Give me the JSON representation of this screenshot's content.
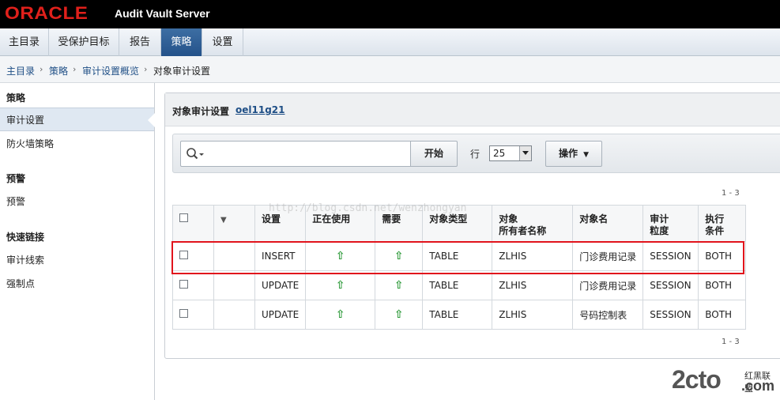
{
  "banner": {
    "logo": "ORACLE",
    "product": "Audit Vault Server"
  },
  "tabs": [
    {
      "label": "主目录",
      "active": false
    },
    {
      "label": "受保护目标",
      "active": false
    },
    {
      "label": "报告",
      "active": false
    },
    {
      "label": "策略",
      "active": true
    },
    {
      "label": "设置",
      "active": false
    }
  ],
  "breadcrumb": [
    "主目录",
    "策略",
    "审计设置概览",
    "对象审计设置"
  ],
  "sidebar": {
    "sections": [
      {
        "heading": "策略",
        "items": [
          {
            "label": "审计设置",
            "active": true
          },
          {
            "label": "防火墙策略",
            "active": false
          }
        ]
      },
      {
        "heading": "预警",
        "items": [
          {
            "label": "预警",
            "active": false
          }
        ]
      },
      {
        "heading": "快速链接",
        "items": [
          {
            "label": "审计线索",
            "active": false
          },
          {
            "label": "强制点",
            "active": false
          }
        ]
      }
    ]
  },
  "panel": {
    "title": "对象审计设置",
    "target_link": "oel11g21"
  },
  "toolbar": {
    "search_value": "",
    "go_label": "开始",
    "rows_label": "行",
    "rows_value": "25",
    "actions_label": "操作"
  },
  "range_top": "1 - 3",
  "range_bottom": "1 - 3",
  "table": {
    "headers": [
      "",
      "",
      "设置",
      "正在使用",
      "需要",
      "对象类型",
      "对象\n所有者名称",
      "对象名",
      "审计\n粒度",
      "执行\n条件"
    ],
    "rows": [
      {
        "setting": "INSERT",
        "type": "TABLE",
        "owner": "ZLHIS",
        "name": "门诊费用记录",
        "granularity": "SESSION",
        "condition": "BOTH"
      },
      {
        "setting": "UPDATE",
        "type": "TABLE",
        "owner": "ZLHIS",
        "name": "门诊费用记录",
        "granularity": "SESSION",
        "condition": "BOTH"
      },
      {
        "setting": "UPDATE",
        "type": "TABLE",
        "owner": "ZLHIS",
        "name": "号码控制表",
        "granularity": "SESSION",
        "condition": "BOTH"
      }
    ],
    "in_use_symbol": "⇧",
    "required_symbol": "⇧"
  },
  "watermark": "http://blog.csdn.net/wenzhongyan",
  "site_logo": {
    "main": "2cto",
    "tag": "红黑联盟",
    "domain": ".com"
  },
  "colors": {
    "brand_red": "#e0201b",
    "active_tab": "#24528a",
    "link": "#1f4f86",
    "highlight": "#e1141c",
    "arrow": "#2e9a3a"
  }
}
